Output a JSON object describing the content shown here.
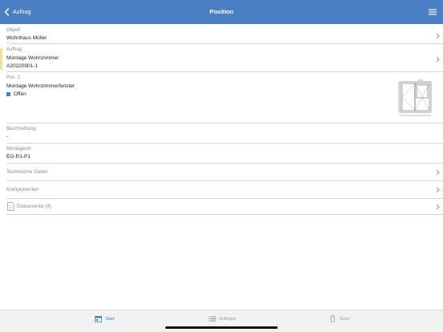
{
  "navbar": {
    "back_label": "Auftrag",
    "title": "Position",
    "color": "#4a7fc1"
  },
  "objekt": {
    "label": "Objekt",
    "value": "Wohnhaus Müller"
  },
  "auftrag": {
    "label": "Auftrag",
    "value": "Montage Wohnzimmer",
    "number": "A20220901-1",
    "accent_color": "#f1e199"
  },
  "position": {
    "label": "Pos. 1",
    "value": "Montage Wohnzimmerfenster",
    "status": "Offen",
    "status_color": "#3a85d6"
  },
  "beschreibung": {
    "label": "Beschreibung",
    "value": "-"
  },
  "montageort": {
    "label": "Montageort",
    "value": "EG-R1-P1"
  },
  "technische_daten": {
    "label": "Technische Daten"
  },
  "komponenten": {
    "label": "Komponenten"
  },
  "dokumente": {
    "label": "Dokumente (4)"
  },
  "tabbar": {
    "tabs": [
      {
        "label": "Start",
        "icon": "calendar-icon",
        "active": true
      },
      {
        "label": "Aufträge",
        "icon": "list-icon",
        "active": false
      },
      {
        "label": "Scan",
        "icon": "scanner-icon",
        "active": false
      }
    ],
    "active_color": "#3a7cc6"
  }
}
